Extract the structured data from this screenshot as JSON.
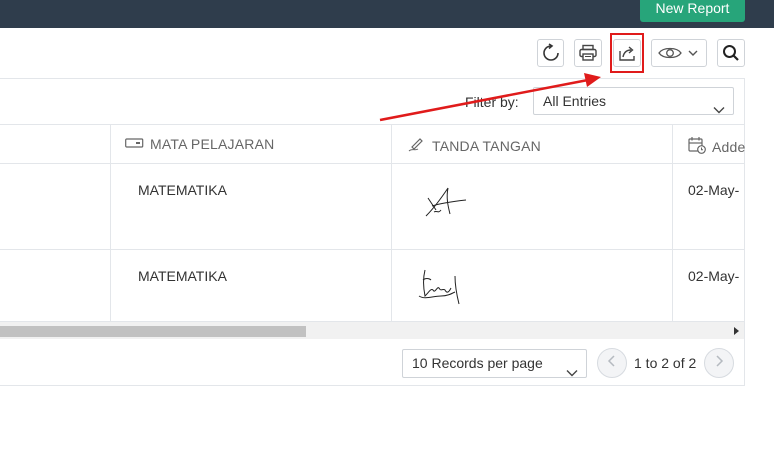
{
  "header": {
    "new_report_label": "New Report"
  },
  "toolbar": {
    "icons": [
      "refresh-icon",
      "print-icon",
      "export-share-icon",
      "eye-icon",
      "search-icon"
    ]
  },
  "filter": {
    "label": "Filter by:",
    "selected": "All Entries"
  },
  "table": {
    "columns": [
      {
        "label": "MATA PELAJARAN",
        "icon": "field-icon"
      },
      {
        "label": "TANDA TANGAN",
        "icon": "signature-pen-icon"
      },
      {
        "label": "Adde",
        "icon": "calendar-clock-icon"
      }
    ],
    "rows": [
      {
        "mata_pelajaran": "MATEMATIKA",
        "added": "02-May-"
      },
      {
        "mata_pelajaran": "MATEMATIKA",
        "added": "02-May-"
      }
    ]
  },
  "pagination": {
    "records_per_page": "10 Records per page",
    "range_text": "1 to 2 of 2"
  },
  "colors": {
    "topbar": "#2f3d4c",
    "primary_button": "#27a57a",
    "highlight": "#e01b1b",
    "arrow": "#e01b1b"
  }
}
